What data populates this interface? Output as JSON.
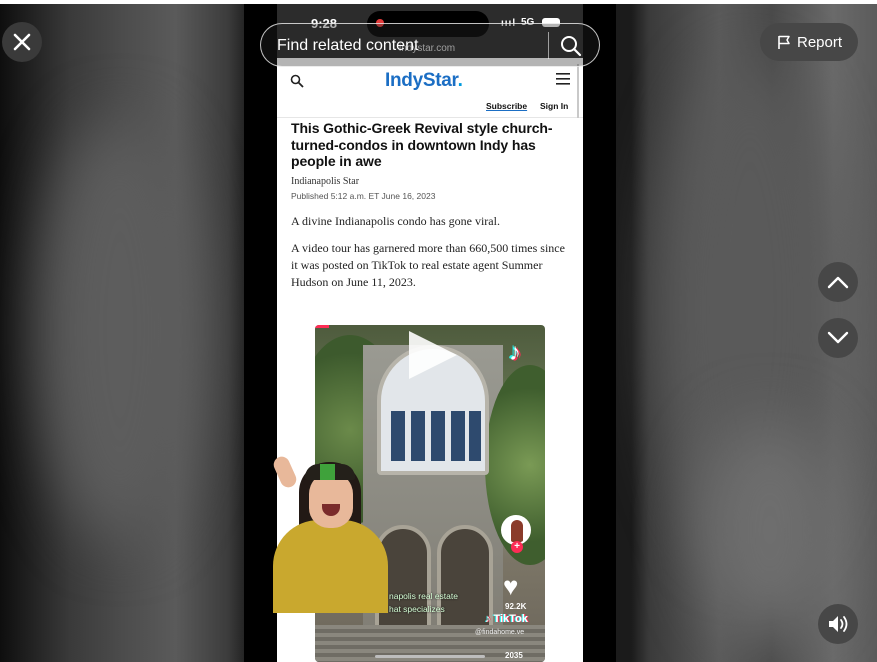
{
  "overlay": {
    "search_placeholder": "Find related content",
    "report_label": "Report"
  },
  "phone": {
    "status": {
      "time": "9:28",
      "signal": "ıııl",
      "network": "5G",
      "url": "indystar.com"
    },
    "nav": {
      "logo": "IndyStar",
      "logo_dot": ".",
      "subscribe": "Subscribe",
      "signin": "Sign In"
    },
    "article": {
      "headline": "This Gothic-Greek Revival style church-turned-condos in downtown Indy has people in awe",
      "byline": "Indianapolis Star",
      "published": "Published 5:12 a.m. ET June 16, 2023",
      "paragraph1": "A divine Indianapolis condo has gone viral.",
      "paragraph2": "A video tour has garnered more than 660,500 times since it was posted on TikTok to real estate agent Summer Hudson on June 11, 2023."
    },
    "tiktok": {
      "likes": "92.2K",
      "watermark": "TikTok",
      "handle": "@findahome.ve",
      "comments": "2035",
      "caption_line1": "napolis real estate",
      "caption_line2": "hat specializes"
    }
  },
  "colors": {
    "brand_blue": "#1b6ec4",
    "tiktok_red": "#fe2c55",
    "tiktok_cyan": "#25f4ee"
  }
}
